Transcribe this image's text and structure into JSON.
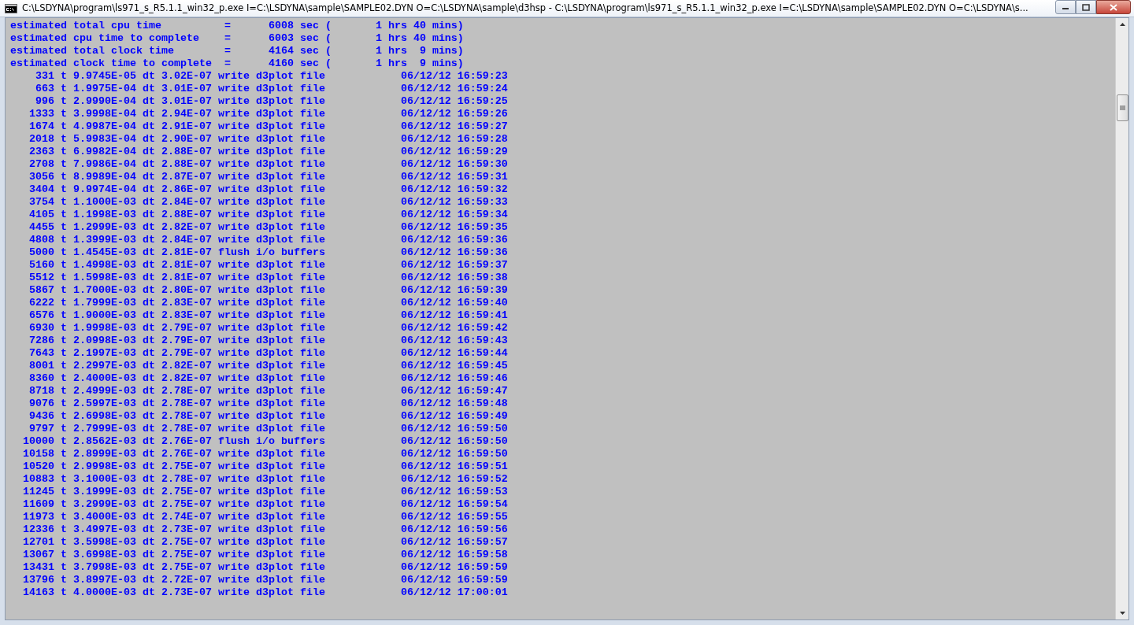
{
  "window": {
    "title": "C:\\LSDYNA\\program\\ls971_s_R5.1.1_win32_p.exe  I=C:\\LSDYNA\\sample\\SAMPLE02.DYN O=C:\\LSDYNA\\sample\\d3hsp - C:\\LSDYNA\\program\\ls971_s_R5.1.1_win32_p.exe   I=C:\\LSDYNA\\sample\\SAMPLE02.DYN O=C:\\LSDYNA\\s..."
  },
  "console_lines": [
    "estimated total cpu time          =      6008 sec (       1 hrs 40 mins)",
    "estimated cpu time to complete    =      6003 sec (       1 hrs 40 mins)",
    "estimated total clock time        =      4164 sec (       1 hrs  9 mins)",
    "estimated clock time to complete  =      4160 sec (       1 hrs  9 mins)",
    "    331 t 9.9745E-05 dt 3.02E-07 write d3plot file            06/12/12 16:59:23",
    "    663 t 1.9975E-04 dt 3.01E-07 write d3plot file            06/12/12 16:59:24",
    "    996 t 2.9990E-04 dt 3.01E-07 write d3plot file            06/12/12 16:59:25",
    "   1333 t 3.9998E-04 dt 2.94E-07 write d3plot file            06/12/12 16:59:26",
    "   1674 t 4.9987E-04 dt 2.91E-07 write d3plot file            06/12/12 16:59:27",
    "   2018 t 5.9983E-04 dt 2.90E-07 write d3plot file            06/12/12 16:59:28",
    "   2363 t 6.9982E-04 dt 2.88E-07 write d3plot file            06/12/12 16:59:29",
    "   2708 t 7.9986E-04 dt 2.88E-07 write d3plot file            06/12/12 16:59:30",
    "   3056 t 8.9989E-04 dt 2.87E-07 write d3plot file            06/12/12 16:59:31",
    "   3404 t 9.9974E-04 dt 2.86E-07 write d3plot file            06/12/12 16:59:32",
    "   3754 t 1.1000E-03 dt 2.84E-07 write d3plot file            06/12/12 16:59:33",
    "   4105 t 1.1998E-03 dt 2.88E-07 write d3plot file            06/12/12 16:59:34",
    "   4455 t 1.2999E-03 dt 2.82E-07 write d3plot file            06/12/12 16:59:35",
    "   4808 t 1.3999E-03 dt 2.84E-07 write d3plot file            06/12/12 16:59:36",
    "   5000 t 1.4545E-03 dt 2.81E-07 flush i/o buffers            06/12/12 16:59:36",
    "   5160 t 1.4998E-03 dt 2.81E-07 write d3plot file            06/12/12 16:59:37",
    "   5512 t 1.5998E-03 dt 2.81E-07 write d3plot file            06/12/12 16:59:38",
    "   5867 t 1.7000E-03 dt 2.80E-07 write d3plot file            06/12/12 16:59:39",
    "   6222 t 1.7999E-03 dt 2.83E-07 write d3plot file            06/12/12 16:59:40",
    "   6576 t 1.9000E-03 dt 2.83E-07 write d3plot file            06/12/12 16:59:41",
    "   6930 t 1.9998E-03 dt 2.79E-07 write d3plot file            06/12/12 16:59:42",
    "   7286 t 2.0998E-03 dt 2.79E-07 write d3plot file            06/12/12 16:59:43",
    "   7643 t 2.1997E-03 dt 2.79E-07 write d3plot file            06/12/12 16:59:44",
    "   8001 t 2.2997E-03 dt 2.82E-07 write d3plot file            06/12/12 16:59:45",
    "   8360 t 2.4000E-03 dt 2.82E-07 write d3plot file            06/12/12 16:59:46",
    "   8718 t 2.4999E-03 dt 2.78E-07 write d3plot file            06/12/12 16:59:47",
    "   9076 t 2.5997E-03 dt 2.78E-07 write d3plot file            06/12/12 16:59:48",
    "   9436 t 2.6998E-03 dt 2.78E-07 write d3plot file            06/12/12 16:59:49",
    "   9797 t 2.7999E-03 dt 2.78E-07 write d3plot file            06/12/12 16:59:50",
    "  10000 t 2.8562E-03 dt 2.76E-07 flush i/o buffers            06/12/12 16:59:50",
    "  10158 t 2.8999E-03 dt 2.76E-07 write d3plot file            06/12/12 16:59:50",
    "  10520 t 2.9998E-03 dt 2.75E-07 write d3plot file            06/12/12 16:59:51",
    "  10883 t 3.1000E-03 dt 2.78E-07 write d3plot file            06/12/12 16:59:52",
    "  11245 t 3.1999E-03 dt 2.75E-07 write d3plot file            06/12/12 16:59:53",
    "  11609 t 3.2999E-03 dt 2.75E-07 write d3plot file            06/12/12 16:59:54",
    "  11973 t 3.4000E-03 dt 2.74E-07 write d3plot file            06/12/12 16:59:55",
    "  12336 t 3.4997E-03 dt 2.73E-07 write d3plot file            06/12/12 16:59:56",
    "  12701 t 3.5998E-03 dt 2.75E-07 write d3plot file            06/12/12 16:59:57",
    "  13067 t 3.6998E-03 dt 2.75E-07 write d3plot file            06/12/12 16:59:58",
    "  13431 t 3.7998E-03 dt 2.75E-07 write d3plot file            06/12/12 16:59:59",
    "  13796 t 3.8997E-03 dt 2.72E-07 write d3plot file            06/12/12 16:59:59",
    "  14163 t 4.0000E-03 dt 2.73E-07 write d3plot file            06/12/12 17:00:01"
  ]
}
